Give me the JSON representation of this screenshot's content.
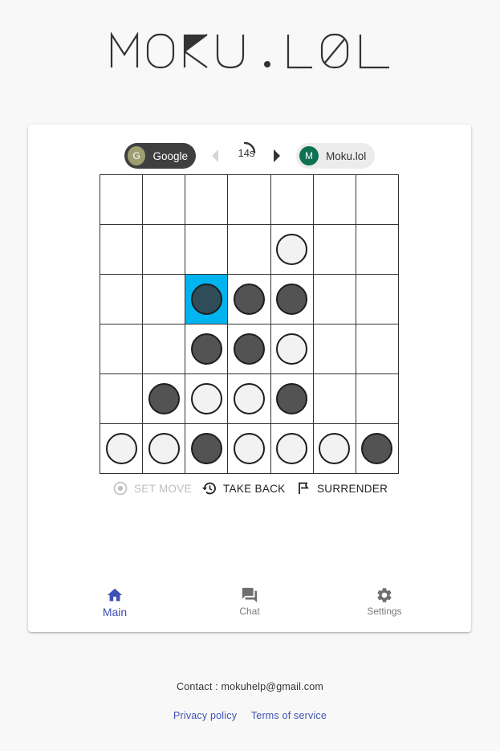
{
  "logo": {
    "text": "MOKU.LOL"
  },
  "players": {
    "player1": {
      "name": "Google",
      "initial": "G",
      "color": "#9e9e72"
    },
    "player2": {
      "name": "Moku.lol",
      "initial": "M",
      "color": "#0f7152"
    }
  },
  "timer": {
    "label": "14s"
  },
  "board": {
    "cols": 7,
    "rows": 6,
    "highlight": {
      "row": 2,
      "col": 2
    },
    "cells": [
      [
        "",
        "",
        "",
        "",
        "",
        "",
        ""
      ],
      [
        "",
        "",
        "",
        "",
        "W",
        "",
        ""
      ],
      [
        "",
        "",
        "B",
        "B",
        "B",
        "",
        ""
      ],
      [
        "",
        "",
        "B",
        "B",
        "W",
        "",
        ""
      ],
      [
        "",
        "B",
        "W",
        "W",
        "B",
        "",
        ""
      ],
      [
        "W",
        "W",
        "B",
        "W",
        "W",
        "W",
        "B"
      ]
    ],
    "colors": {
      "B": "#535353",
      "W": "#f2f2f2",
      "highlight": "#00b4f0"
    }
  },
  "actions": {
    "set_move": "SET MOVE",
    "take_back": "TAKE BACK",
    "surrender": "SURRENDER"
  },
  "tabs": {
    "main": "Main",
    "chat": "Chat",
    "settings": "Settings",
    "active": "Main"
  },
  "footer": {
    "contact": "Contact : mokuhelp@gmail.com",
    "privacy": "Privacy policy",
    "terms": "Terms of service"
  }
}
